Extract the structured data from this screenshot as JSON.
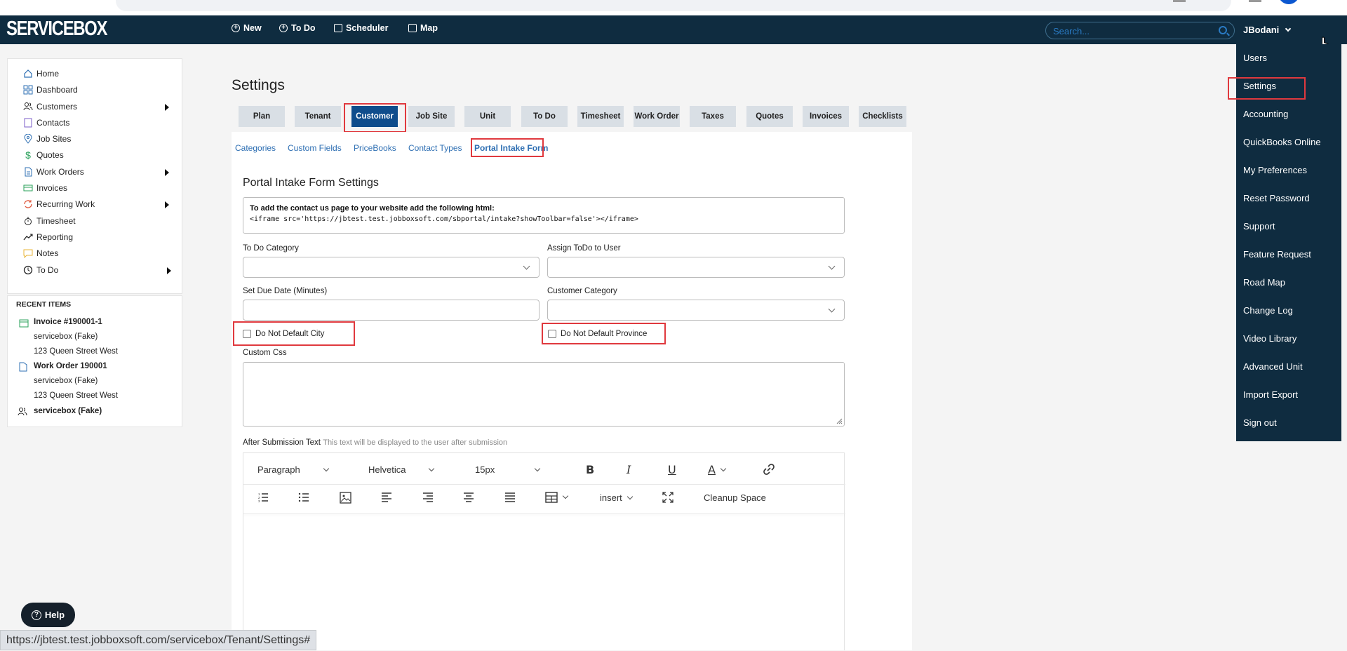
{
  "app": {
    "logo": "SERVICEBOX"
  },
  "topnav": {
    "new": "New",
    "todo": "To Do",
    "scheduler": "Scheduler",
    "map": "Map"
  },
  "search": {
    "placeholder": "Search..."
  },
  "user": {
    "name": "JBodani"
  },
  "sidebar": {
    "items": [
      {
        "label": "Home",
        "icon": "home-icon"
      },
      {
        "label": "Dashboard",
        "icon": "dashboard-icon"
      },
      {
        "label": "Customers",
        "icon": "users-icon"
      },
      {
        "label": "Contacts",
        "icon": "book-icon"
      },
      {
        "label": "Job Sites",
        "icon": "location-pin-icon"
      },
      {
        "label": "Quotes",
        "icon": "dollar-icon"
      },
      {
        "label": "Work Orders",
        "icon": "document-icon"
      },
      {
        "label": "Invoices",
        "icon": "card-icon"
      },
      {
        "label": "Recurring Work",
        "icon": "refresh-icon"
      },
      {
        "label": "Timesheet",
        "icon": "stopwatch-icon"
      },
      {
        "label": "Reporting",
        "icon": "trend-icon"
      },
      {
        "label": "Notes",
        "icon": "note-icon"
      },
      {
        "label": "To Do",
        "icon": "clock-icon"
      }
    ]
  },
  "recent": {
    "header": "RECENT ITEMS",
    "invoice_title": "Invoice #190001-1",
    "invoice_customer": "servicebox (Fake)",
    "invoice_address": "123 Queen Street West",
    "wo_title": "Work Order 190001",
    "wo_customer": "servicebox (Fake)",
    "wo_address": "123 Queen Street West",
    "customer": "servicebox (Fake)"
  },
  "page": {
    "title": "Settings"
  },
  "tabs": [
    "Plan",
    "Tenant",
    "Customer",
    "Job Site",
    "Unit",
    "To Do",
    "Timesheet",
    "Work Order",
    "Taxes",
    "Quotes",
    "Invoices",
    "Checklists"
  ],
  "subtabs": [
    "Categories",
    "Custom Fields",
    "PriceBooks",
    "Contact Types",
    "Portal Intake Form"
  ],
  "form": {
    "section_title": "Portal Intake Form Settings",
    "info_line1": "To add the contact us page to your website add the following html:",
    "info_line2": "<iframe src='https://jbtest.test.jobboxsoft.com/sbportal/intake?showToolbar=false'></iframe>",
    "todo_category_label": "To Do Category",
    "assign_label": "Assign ToDo to User",
    "due_date_label": "Set Due Date (Minutes)",
    "customer_category_label": "Customer Category",
    "no_default_city": "Do Not Default City",
    "no_default_province": "Do Not Default Province",
    "custom_css_label": "Custom Css",
    "after_submission_label": "After Submission Text",
    "after_submission_hint": "This text will be displayed to the user after submission"
  },
  "editor": {
    "block": "Paragraph",
    "font": "Helvetica",
    "size": "15px",
    "insert": "insert",
    "cleanup": "Cleanup Space"
  },
  "user_menu": [
    "Users",
    "Settings",
    "Accounting",
    "QuickBooks Online",
    "My Preferences",
    "Reset Password",
    "Support",
    "Feature Request",
    "Road Map",
    "Change Log",
    "Video Library",
    "Advanced Unit",
    "Import Export",
    "Sign out"
  ],
  "help": {
    "label": "Help"
  },
  "status_url": "https://jbtest.test.jobboxsoft.com/servicebox/Tenant/Settings#",
  "colors": {
    "topbar": "#0f2c40",
    "accent": "#0f4d8c",
    "highlight": "#e0393e",
    "link": "#2e6fb3"
  }
}
